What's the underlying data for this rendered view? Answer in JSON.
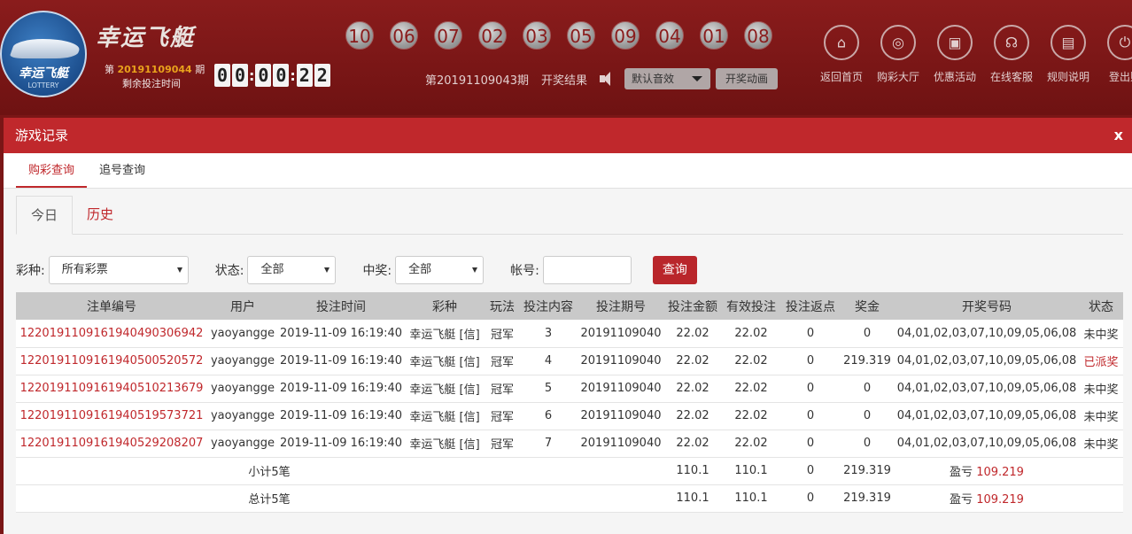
{
  "header": {
    "logo_text": "幸运飞艇",
    "logo_sub": "LOTTERY",
    "game_title": "幸运飞艇",
    "period_prefix": "第",
    "period_number": "20191109044",
    "period_suffix": "期",
    "remain_label": "剩余投注时间",
    "timer_digits": [
      "0",
      "0",
      "0",
      "0",
      "2",
      "2"
    ],
    "last_numbers": [
      "10",
      "06",
      "07",
      "02",
      "03",
      "05",
      "09",
      "04",
      "01",
      "08"
    ],
    "result_period": "第20191109043期",
    "result_label": "开奖结果",
    "sound_select": "默认音效",
    "anim_button": "开奖动画",
    "nav": [
      {
        "label": "返回首页",
        "icon": "home-icon",
        "glyph": "⌂"
      },
      {
        "label": "购彩大厅",
        "icon": "lottery-hall-icon",
        "glyph": "◎"
      },
      {
        "label": "优惠活动",
        "icon": "promotion-icon",
        "glyph": "▣"
      },
      {
        "label": "在线客服",
        "icon": "headset-icon",
        "glyph": "☊"
      },
      {
        "label": "规则说明",
        "icon": "rules-icon",
        "glyph": "▤"
      },
      {
        "label": "登出账",
        "icon": "logout-icon",
        "glyph": "⏻"
      }
    ]
  },
  "modal": {
    "title": "游戏记录",
    "close": "x",
    "tabs": [
      "购彩查询",
      "追号查询"
    ],
    "subtabs": [
      "今日",
      "历史"
    ],
    "filters": {
      "lottery_label": "彩种:",
      "lottery_value": "所有彩票",
      "status_label": "状态:",
      "status_value": "全部",
      "win_label": "中奖:",
      "win_value": "全部",
      "account_label": "帐号:",
      "account_value": "",
      "query_button": "查询"
    },
    "columns": [
      "注单编号",
      "用户",
      "投注时间",
      "彩种",
      "玩法",
      "投注内容",
      "投注期号",
      "投注金额",
      "有效投注",
      "投注返点",
      "奖金",
      "开奖号码",
      "状态"
    ],
    "rows": [
      [
        "12201911091619404903069​42",
        "yaoyangge",
        "2019-11-09 16:19:40",
        "幸运飞艇 [信]",
        "冠军",
        "3",
        "20191109040",
        "22.02",
        "22.02",
        "0",
        "0",
        "04,01,02,03,07,10,09,05,06,08",
        "未中奖"
      ],
      [
        "122019110916194050052​0572",
        "yaoyangge",
        "2019-11-09 16:19:40",
        "幸运飞艇 [信]",
        "冠军",
        "4",
        "20191109040",
        "22.02",
        "22.02",
        "0",
        "219.319",
        "04,01,02,03,07,10,09,05,06,08",
        "已派奖"
      ],
      [
        "12201911091619405102136​79",
        "yaoyangge",
        "2019-11-09 16:19:40",
        "幸运飞艇 [信]",
        "冠军",
        "5",
        "20191109040",
        "22.02",
        "22.02",
        "0",
        "0",
        "04,01,02,03,07,10,09,05,06,08",
        "未中奖"
      ],
      [
        "12201911091619405195737​21",
        "yaoyangge",
        "2019-11-09 16:19:40",
        "幸运飞艇 [信]",
        "冠军",
        "6",
        "20191109040",
        "22.02",
        "22.02",
        "0",
        "0",
        "04,01,02,03,07,10,09,05,06,08",
        "未中奖"
      ],
      [
        "12201911091619405292082​07",
        "yaoyangge",
        "2019-11-09 16:19:40",
        "幸运飞艇 [信]",
        "冠军",
        "7",
        "20191109040",
        "22.02",
        "22.02",
        "0",
        "0",
        "04,01,02,03,07,10,09,05,06,08",
        "未中奖"
      ]
    ],
    "subtotal": {
      "label": "小计5笔",
      "amount": "110.1",
      "valid": "110.1",
      "rebate": "0",
      "bonus": "219.319",
      "pl_label": "盈亏",
      "pl_value": "109.219"
    },
    "total": {
      "label": "总计5笔",
      "amount": "110.1",
      "valid": "110.1",
      "rebate": "0",
      "bonus": "219.319",
      "pl_label": "盈亏",
      "pl_value": "109.219"
    }
  }
}
